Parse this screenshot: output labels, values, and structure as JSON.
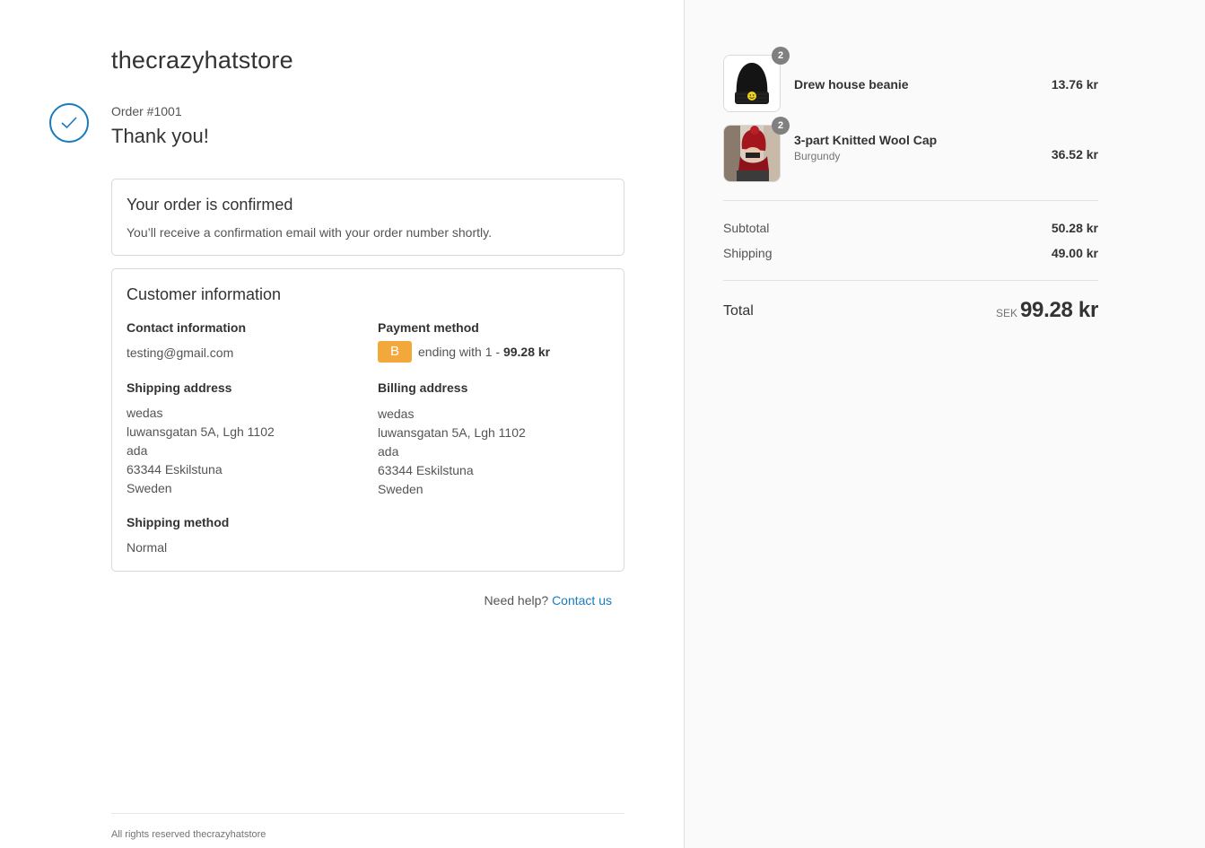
{
  "store": {
    "name": "thecrazyhatstore"
  },
  "order": {
    "number": "Order #1001",
    "thank_you": "Thank you!"
  },
  "confirmed": {
    "title": "Your order is confirmed",
    "text": "You’ll receive a confirmation email with your order number shortly."
  },
  "customer": {
    "title": "Customer information",
    "contact_label": "Contact information",
    "contact_value": "testing@gmail.com",
    "payment_label": "Payment method",
    "payment_badge": "B",
    "payment_text": "ending with 1 - ",
    "payment_amount": "99.28 kr",
    "shipping_address_label": "Shipping address",
    "shipping_address": [
      "wedas",
      "luwansgatan 5A, Lgh 1102",
      "ada",
      "63344 Eskilstuna",
      "Sweden"
    ],
    "billing_address_label": "Billing address",
    "billing_address": [
      "wedas",
      "luwansgatan 5A, Lgh 1102",
      "ada",
      "63344 Eskilstuna",
      "Sweden"
    ],
    "shipping_method_label": "Shipping method",
    "shipping_method_value": "Normal"
  },
  "help": {
    "text": "Need help? ",
    "link": "Contact us"
  },
  "footer": {
    "text": "All rights reserved thecrazyhatstore"
  },
  "summary": {
    "items": [
      {
        "name": "Drew house beanie",
        "variant": "",
        "quantity": "2",
        "price": "13.76 kr",
        "image_icon": "black-beanie-image"
      },
      {
        "name": "3-part Knitted Wool Cap",
        "variant": "Burgundy",
        "quantity": "2",
        "price": "36.52 kr",
        "image_icon": "red-wool-cap-photo"
      }
    ],
    "subtotal_label": "Subtotal",
    "subtotal_value": "50.28 kr",
    "shipping_label": "Shipping",
    "shipping_value": "49.00 kr",
    "total_label": "Total",
    "currency": "SEK",
    "total_value": "99.28 kr"
  },
  "colors": {
    "accent": "#197bbd",
    "payment_badge": "#f2a83b",
    "sidebar_bg": "#fafafa"
  }
}
